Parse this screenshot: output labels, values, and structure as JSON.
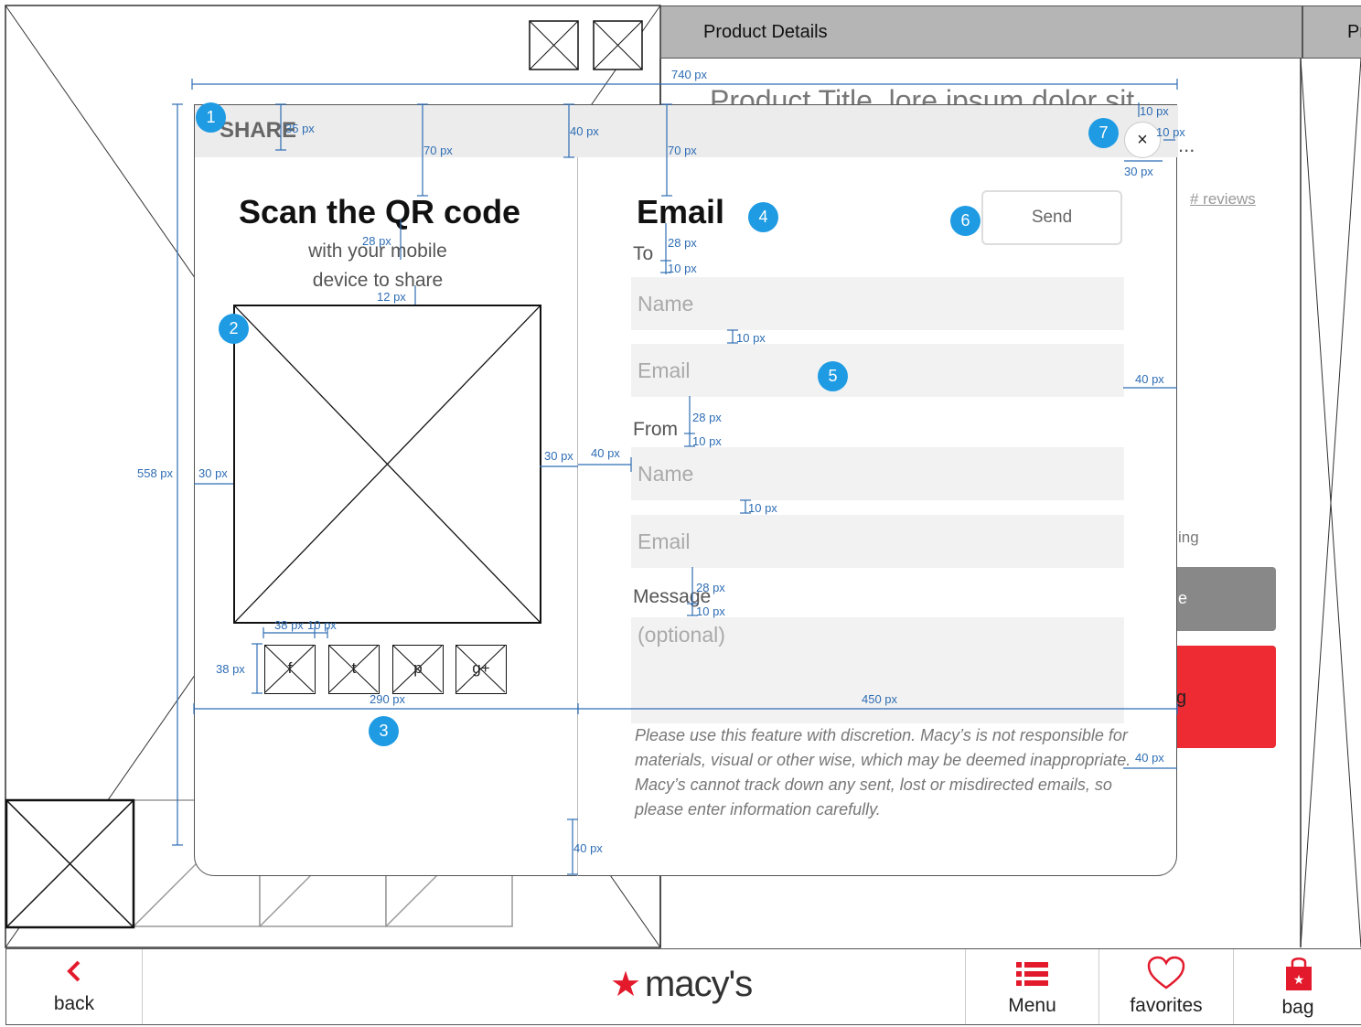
{
  "background": {
    "header_product_details": "Product Details",
    "header_right_cut": "Pr",
    "product_title_partial": "Product Title, lore ipsum dolor sit",
    "ellipsis": "...",
    "reviews_link": "# reviews",
    "ing_text": "ing",
    "gray_button_partial": "e",
    "red_button_partial": "g"
  },
  "bottom_nav": {
    "back_label": "back",
    "logo_text": "macy's",
    "menu_label": "Menu",
    "favorites_label": "favorites",
    "bag_label": "bag"
  },
  "modal": {
    "share_title": "SHARE",
    "close_symbol": "×",
    "qr": {
      "heading": "Scan the QR code",
      "sub_line1": "with your mobile",
      "sub_line2": "device to share"
    },
    "social": [
      {
        "label": "f",
        "icon": "facebook-icon"
      },
      {
        "label": "t",
        "icon": "twitter-icon"
      },
      {
        "label": "p",
        "icon": "pinterest-icon"
      },
      {
        "label": "g+",
        "icon": "google-plus-icon"
      }
    ],
    "email": {
      "heading": "Email",
      "send_label": "Send",
      "to_label": "To",
      "to_name_placeholder": "Name",
      "to_email_placeholder": "Email",
      "from_label": "From",
      "from_name_placeholder": "Name",
      "from_email_placeholder": "Email",
      "message_label": "Message",
      "message_placeholder": "(optional)",
      "disclaimer": "Please use this feature with discretion. Macy’s is not responsible for  materials, visual or other wise, which may be deemed inappropriate. Macy’s cannot track down any sent, lost or misdirected emails, so please enter information carefully."
    }
  },
  "annotations": {
    "badges": [
      "1",
      "2",
      "3",
      "4",
      "5",
      "6",
      "7"
    ],
    "measurements": {
      "w740": "740 px",
      "h558": "558 px",
      "h35": "35 px",
      "h70a": "70 px",
      "h40top": "40 px",
      "h70b": "70 px",
      "h10a": "10 px",
      "w10a": "10 px",
      "w30close": "30 px",
      "h28a": "28 px",
      "h12": "12 px",
      "h28b": "28 px",
      "h10b": "10 px",
      "h10c": "10 px",
      "w40right1": "40 px",
      "h28c": "28 px",
      "h10d": "10 px",
      "w30left": "30 px",
      "w30mid": "30 px",
      "w40mid": "40 px",
      "h10e": "10 px",
      "h28d": "28 px",
      "h10f": "10 px",
      "w38": "38 px",
      "w10b": "10 px",
      "h38": "38 px",
      "w290": "290 px",
      "w450": "450 px",
      "w40right2": "40 px",
      "h40bottom": "40 px"
    }
  }
}
